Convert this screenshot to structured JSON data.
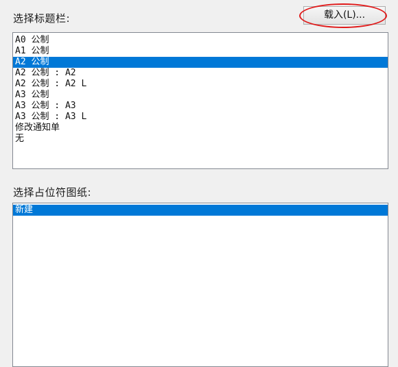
{
  "titleblock": {
    "label": "选择标题栏:",
    "load_button": "载入(L)...",
    "items": [
      {
        "text": "A0 公制",
        "selected": false
      },
      {
        "text": "A1 公制",
        "selected": false
      },
      {
        "text": "A2 公制",
        "selected": true
      },
      {
        "text": "A2 公制 : A2",
        "selected": false
      },
      {
        "text": "A2 公制 : A2 L",
        "selected": false
      },
      {
        "text": "A3 公制",
        "selected": false
      },
      {
        "text": "A3 公制 : A3",
        "selected": false
      },
      {
        "text": "A3 公制 : A3 L",
        "selected": false
      },
      {
        "text": "修改通知单",
        "selected": false
      },
      {
        "text": "无",
        "selected": false
      }
    ]
  },
  "placeholder": {
    "label": "选择占位符图纸:",
    "items": [
      {
        "text": "新建",
        "selected": true
      }
    ]
  },
  "colors": {
    "selection": "#0078d7",
    "annotation_ellipse": "#e01b1b",
    "dialog_background": "#f0f0f0"
  }
}
